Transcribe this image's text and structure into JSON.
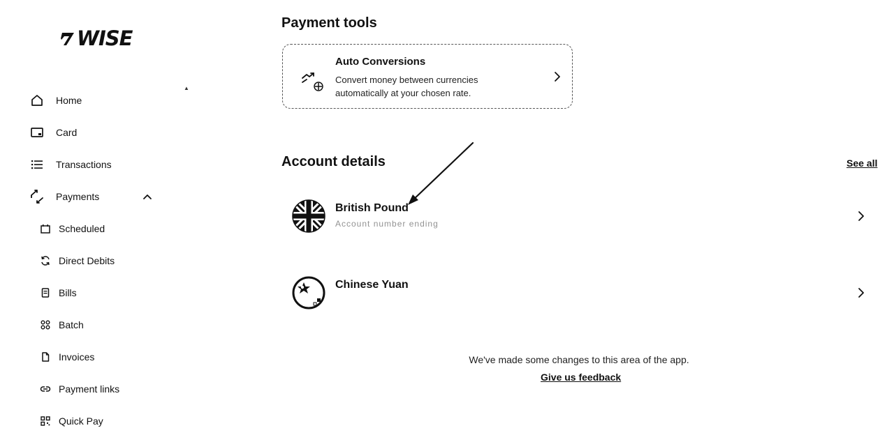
{
  "brand": {
    "name": "WISE"
  },
  "sidebar": {
    "items": [
      {
        "label": "Home",
        "icon": "home-icon"
      },
      {
        "label": "Card",
        "icon": "card-icon"
      },
      {
        "label": "Transactions",
        "icon": "list-icon"
      },
      {
        "label": "Payments",
        "icon": "payments-icon",
        "expanded": true
      }
    ],
    "sub_items": [
      {
        "label": "Scheduled",
        "icon": "calendar-icon"
      },
      {
        "label": "Direct Debits",
        "icon": "refresh-icon"
      },
      {
        "label": "Bills",
        "icon": "bill-icon"
      },
      {
        "label": "Batch",
        "icon": "batch-icon"
      },
      {
        "label": "Invoices",
        "icon": "document-icon"
      },
      {
        "label": "Payment links",
        "icon": "link-icon"
      },
      {
        "label": "Quick Pay",
        "icon": "qr-icon"
      }
    ]
  },
  "payment_tools": {
    "title": "Payment tools",
    "card": {
      "title": "Auto Conversions",
      "description": "Convert money between currencies automatically at your chosen rate."
    }
  },
  "account_details": {
    "title": "Account details",
    "see_all": "See all",
    "accounts": [
      {
        "name": "British Pound",
        "subtitle": "Account number ending"
      },
      {
        "name": "Chinese Yuan",
        "subtitle": ""
      }
    ]
  },
  "notice": {
    "text": "We've made some changes to this area of the app.",
    "link": "Give us feedback"
  }
}
